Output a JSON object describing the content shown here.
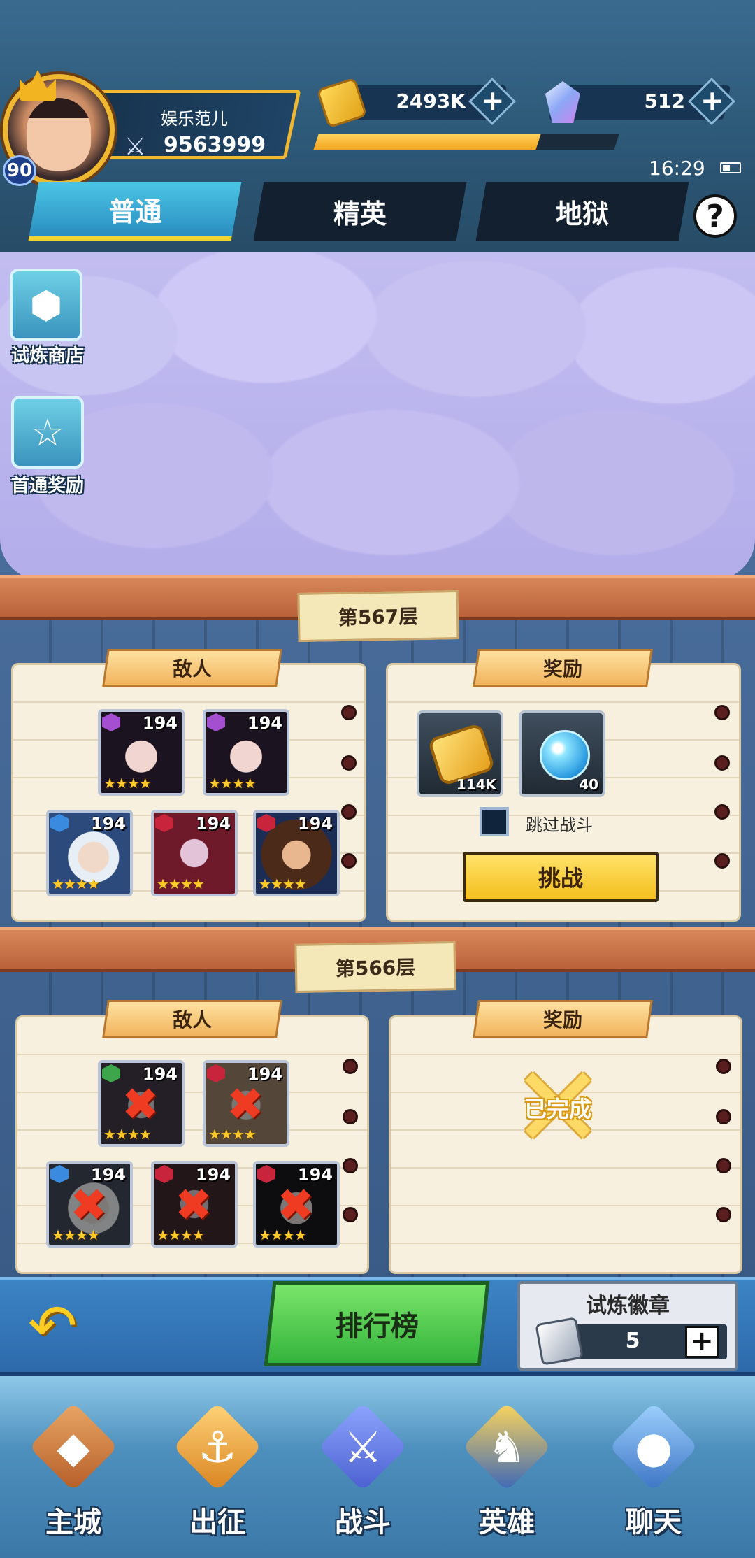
{
  "player": {
    "name": "娱乐范儿",
    "level": "90",
    "power": "9563999",
    "exp_fraction": 0.74
  },
  "resources": {
    "gold": "2493K",
    "gems": "512",
    "plus": "+"
  },
  "status": {
    "time": "16:29"
  },
  "tabs": [
    {
      "label": "普通",
      "active": true
    },
    {
      "label": "精英",
      "active": false
    },
    {
      "label": "地狱",
      "active": false
    }
  ],
  "help": {
    "label": "?"
  },
  "side_buttons": {
    "shop": {
      "label": "试炼商店",
      "icon": "d20-icon"
    },
    "first_clear": {
      "label": "首通奖励",
      "icon": "star-icon"
    }
  },
  "floors": [
    {
      "title": "第567层",
      "enemies_label": "敌人",
      "rewards_label": "奖励",
      "enemies": [
        {
          "level": "194",
          "stars": "★★★★",
          "faction": "purple",
          "defeated": false
        },
        {
          "level": "194",
          "stars": "★★★★",
          "faction": "purple",
          "defeated": false
        },
        {
          "level": "194",
          "stars": "★★★★",
          "faction": "blue",
          "defeated": false
        },
        {
          "level": "194",
          "stars": "★★★★",
          "faction": "red",
          "defeated": false
        },
        {
          "level": "194",
          "stars": "★★★★",
          "faction": "red",
          "defeated": false
        }
      ],
      "rewards": [
        {
          "icon": "gold-coin-icon",
          "count": "114K"
        },
        {
          "icon": "blue-orb-icon",
          "count": "40"
        }
      ],
      "skip_label": "跳过战斗",
      "challenge_label": "挑战"
    },
    {
      "title": "第566层",
      "enemies_label": "敌人",
      "rewards_label": "奖励",
      "enemies": [
        {
          "level": "194",
          "stars": "★★★★",
          "faction": "green",
          "defeated": true
        },
        {
          "level": "194",
          "stars": "★★★★",
          "faction": "red",
          "defeated": true
        },
        {
          "level": "194",
          "stars": "★★★★",
          "faction": "blue",
          "defeated": true
        },
        {
          "level": "194",
          "stars": "★★★★",
          "faction": "red",
          "defeated": true
        },
        {
          "level": "194",
          "stars": "★★★★",
          "faction": "red",
          "defeated": true
        }
      ],
      "completed_label": "已完成"
    }
  ],
  "action_bar": {
    "ranking_label": "排行榜",
    "badge_title": "试炼徽章",
    "badge_count": "5",
    "badge_plus": "+"
  },
  "nav": [
    {
      "label": "主城",
      "icon": "city-book-icon"
    },
    {
      "label": "出征",
      "icon": "ship-icon"
    },
    {
      "label": "战斗",
      "icon": "crossed-swords-icon"
    },
    {
      "label": "英雄",
      "icon": "knight-helmet-icon"
    },
    {
      "label": "聊天",
      "icon": "chat-bubble-icon"
    }
  ],
  "colors": {
    "accent_gold": "#f0b730",
    "tab_active": "#4bc6e6",
    "challenge_yellow": "#f4be1d",
    "ranking_green": "#33b33c",
    "defeated_red": "#ef3b22"
  }
}
